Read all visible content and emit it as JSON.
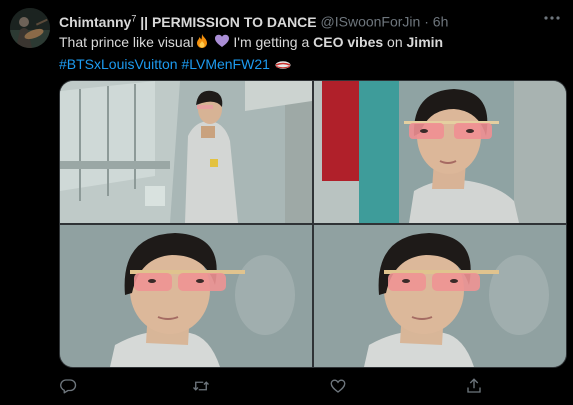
{
  "tweet": {
    "display_name": "Chimtanny",
    "name_superscript": "7",
    "name_suffix": "|| PERMISSION TO DANCE",
    "handle": "@ISwoonForJin",
    "separator": "·",
    "time": "6h",
    "text_part1": "That prince like visual",
    "text_part2": " I'm getting a ",
    "text_bold1": "CEO vibes",
    "text_part3": " on ",
    "text_bold2": "Jimin",
    "hashtag1": "#BTSxLouisVuitton",
    "hashtag2": "#LVMenFW21"
  },
  "icons": {
    "more": "more-horizontal-icon",
    "reply": "reply-icon",
    "retweet": "retweet-icon",
    "like": "like-heart-icon",
    "share": "share-icon"
  },
  "colors": {
    "background": "#000000",
    "text": "#d9d9d9",
    "secondary": "#6e767d",
    "hashtag": "#1d9bf0"
  }
}
